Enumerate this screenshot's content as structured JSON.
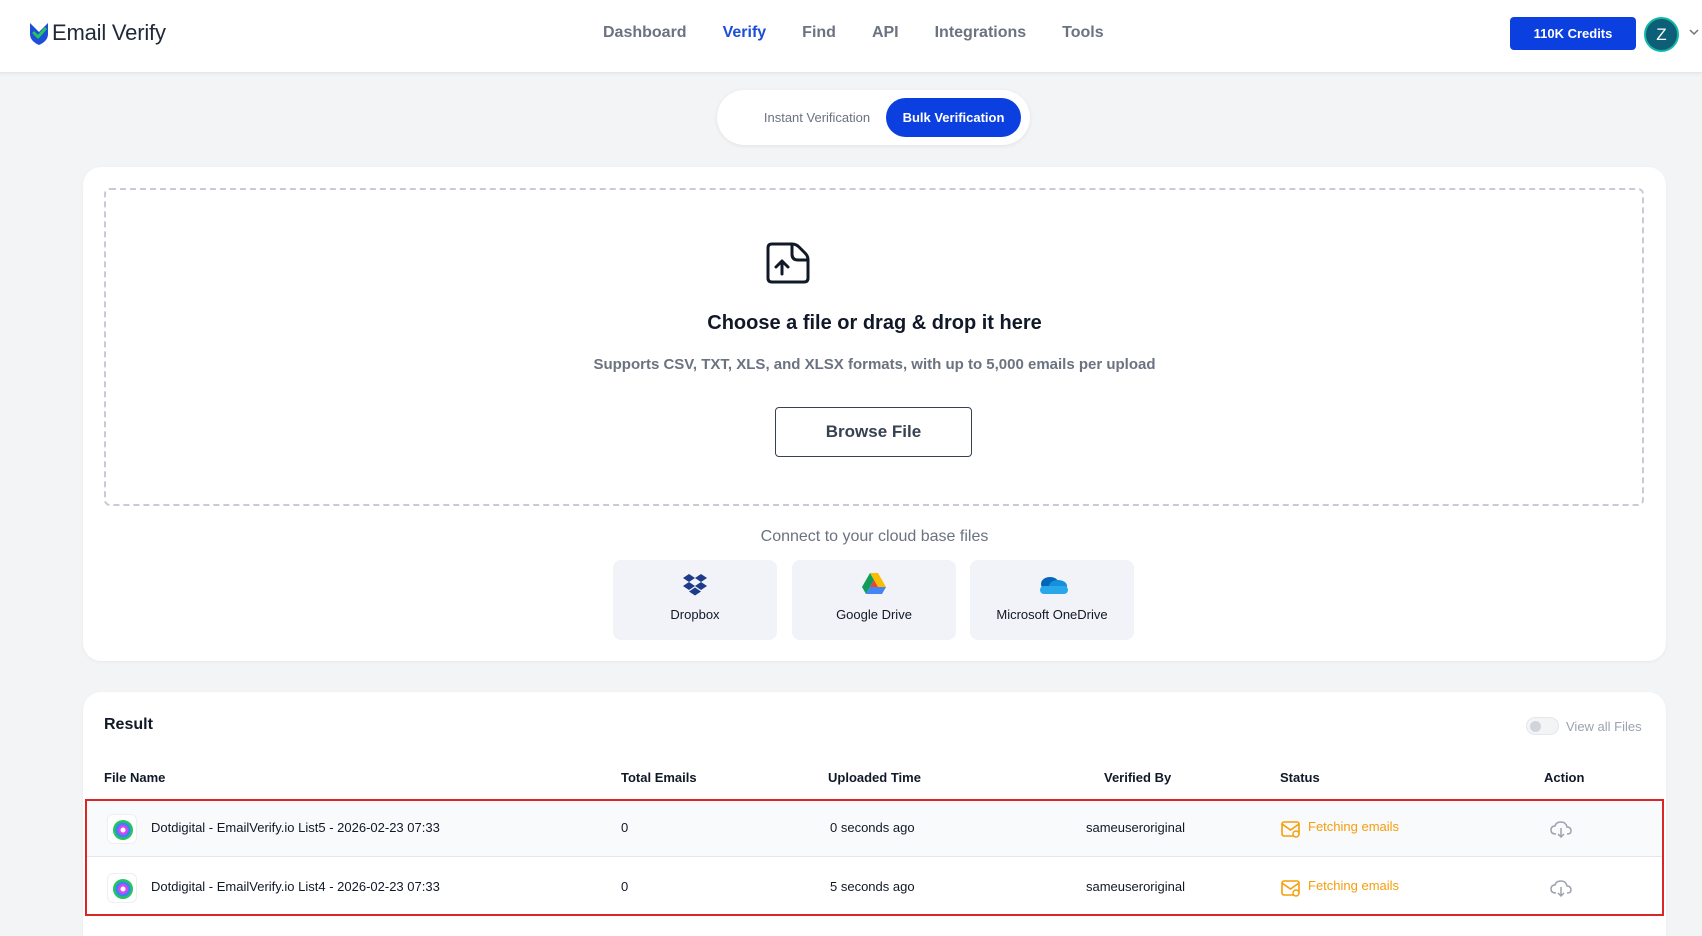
{
  "header": {
    "logo_text": "Email Verify",
    "nav": [
      "Dashboard",
      "Verify",
      "Find",
      "API",
      "Integrations",
      "Tools"
    ],
    "active_nav": "Verify",
    "credits_label": "110K Credits",
    "avatar_initial": "Z"
  },
  "tabs": {
    "instant": "Instant Verification",
    "bulk": "Bulk Verification",
    "active": "bulk"
  },
  "upload": {
    "title": "Choose a file or drag & drop it here",
    "subtitle": "Supports CSV, TXT, XLS, and XLSX formats, with up to 5,000 emails per upload",
    "browse_label": "Browse File",
    "cloud_label": "Connect to your cloud base files",
    "cloud_sources": [
      "Dropbox",
      "Google Drive",
      "Microsoft OneDrive"
    ]
  },
  "result": {
    "title": "Result",
    "view_all_label": "View all Files",
    "view_all_on": false,
    "columns": [
      "File Name",
      "Total Emails",
      "Uploaded Time",
      "Verified By",
      "Status",
      "Action"
    ],
    "rows": [
      {
        "file_name": "Dotdigital - EmailVerify.io List5 - 2026-02-23 07:33",
        "total_emails": "0",
        "uploaded_time": "0 seconds ago",
        "verified_by": "sameuseroriginal",
        "status": "Fetching emails"
      },
      {
        "file_name": "Dotdigital - EmailVerify.io List4 - 2026-02-23 07:33",
        "total_emails": "0",
        "uploaded_time": "5 seconds ago",
        "verified_by": "sameuseroriginal",
        "status": "Fetching emails"
      }
    ]
  },
  "colors": {
    "brand_blue": "#0b3fe0",
    "status_amber": "#f59e0b",
    "highlight_red": "#dc2626"
  }
}
